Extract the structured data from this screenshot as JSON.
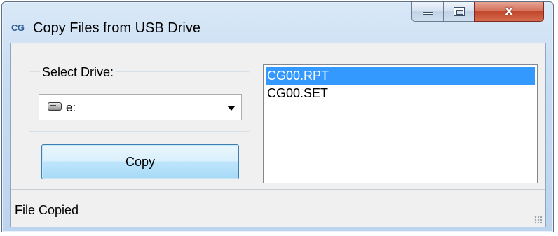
{
  "window": {
    "app_icon_text": "CG",
    "title": "Copy Files from USB Drive",
    "close_glyph": "x"
  },
  "drive": {
    "group_label": "Select Drive:",
    "selected": "e:",
    "icon": "usb-drive-icon"
  },
  "actions": {
    "copy_label": "Copy"
  },
  "files": {
    "items": [
      {
        "name": "CG00.RPT",
        "selected": true
      },
      {
        "name": "CG00.SET",
        "selected": false
      }
    ]
  },
  "status": {
    "text": "File Copied"
  },
  "colors": {
    "selection": "#3399ff",
    "close_button": "#c2452a",
    "copy_button_border": "#3c7fb1"
  }
}
